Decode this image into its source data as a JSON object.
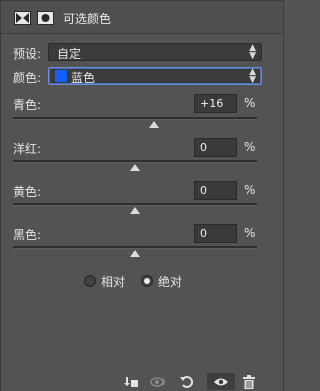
{
  "header": {
    "title": "可选颜色"
  },
  "preset": {
    "label": "预设:",
    "value": "自定"
  },
  "color": {
    "label": "颜色:",
    "value": "蓝色",
    "swatch_color": "#1060ff"
  },
  "sliders": [
    {
      "label": "青色:",
      "value": "+16",
      "unit": "%",
      "level_percent": 16
    },
    {
      "label": "洋红:",
      "value": "0",
      "unit": "%",
      "level_percent": 0
    },
    {
      "label": "黄色:",
      "value": "0",
      "unit": "%",
      "level_percent": 0
    },
    {
      "label": "黑色:",
      "value": "0",
      "unit": "%",
      "level_percent": 0
    }
  ],
  "method": {
    "options": [
      {
        "label": "相对",
        "checked": false
      },
      {
        "label": "绝对",
        "checked": true
      }
    ]
  },
  "footer": {
    "icons": [
      "clip-to-layer-icon",
      "view-previous-state-icon",
      "reset-icon",
      "visibility-eye-icon",
      "trash-icon"
    ]
  }
}
